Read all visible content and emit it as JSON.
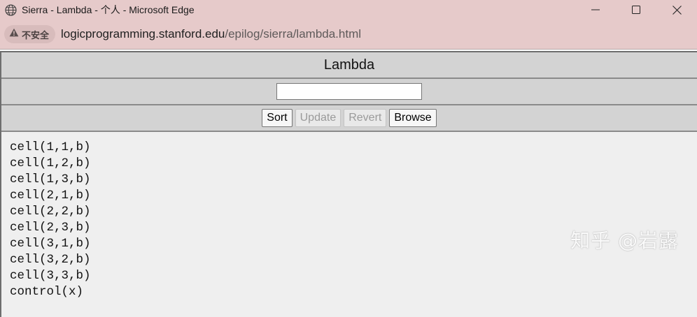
{
  "window": {
    "title": "Sierra - Lambda - 个人 - Microsoft Edge",
    "icon": "globe-icon"
  },
  "addressbar": {
    "security_label": "不安全",
    "security_icon": "warning-icon",
    "url_host": "logicprogramming.stanford.edu",
    "url_path": "/epilog/sierra/lambda.html"
  },
  "page": {
    "heading": "Lambda",
    "input_value": "",
    "buttons": {
      "sort": "Sort",
      "update": "Update",
      "revert": "Revert",
      "browse": "Browse"
    },
    "output_lines": [
      "cell(1,1,b)",
      "cell(1,2,b)",
      "cell(1,3,b)",
      "cell(2,1,b)",
      "cell(2,2,b)",
      "cell(2,3,b)",
      "cell(3,1,b)",
      "cell(3,2,b)",
      "cell(3,3,b)",
      "control(x)"
    ]
  },
  "watermark": "知乎 @岩露"
}
